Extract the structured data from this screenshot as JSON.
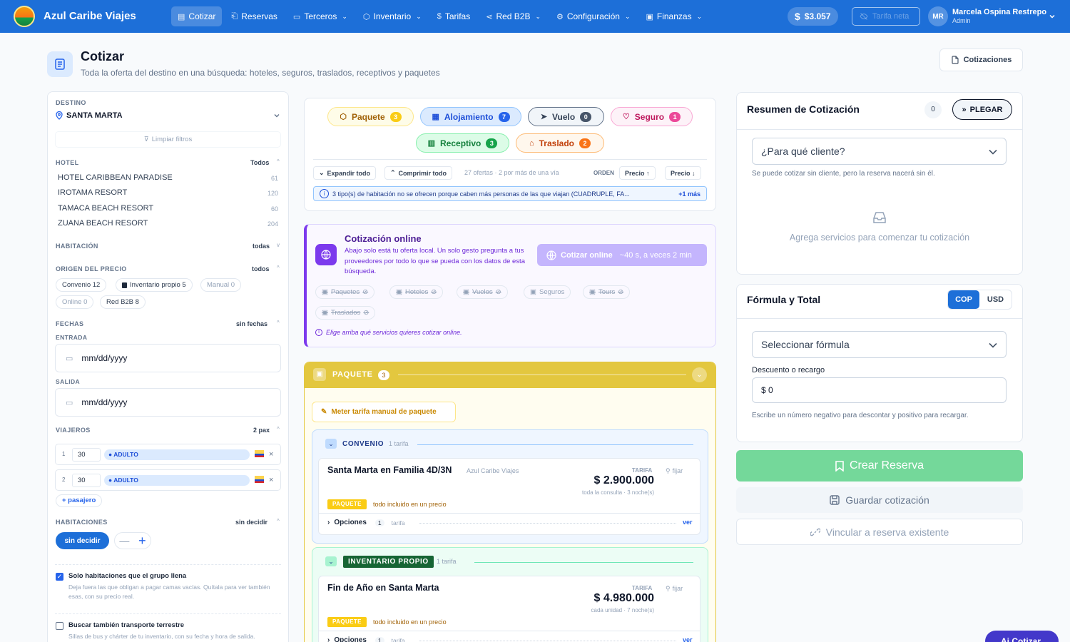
{
  "nav": {
    "brand": "Azul Caribe Viajes",
    "items": [
      {
        "label": "Cotizar",
        "icon": "document-icon",
        "active": true,
        "dropdown": false
      },
      {
        "label": "Reservas",
        "icon": "bookmark-icon",
        "active": false,
        "dropdown": false
      },
      {
        "label": "Terceros",
        "icon": "id-card-icon",
        "active": false,
        "dropdown": true
      },
      {
        "label": "Inventario",
        "icon": "box-icon",
        "active": false,
        "dropdown": true
      },
      {
        "label": "Tarifas",
        "icon": "dollar-icon",
        "active": false,
        "dropdown": false
      },
      {
        "label": "Red B2B",
        "icon": "share-icon",
        "active": false,
        "dropdown": true
      },
      {
        "label": "Configuración",
        "icon": "gear-icon",
        "active": false,
        "dropdown": true
      },
      {
        "label": "Finanzas",
        "icon": "wallet-icon",
        "active": false,
        "dropdown": true
      }
    ],
    "balance": "$3.057",
    "net_rate": "Tarifa neta",
    "user": {
      "initials": "MR",
      "name": "Marcela Ospina Restrepo",
      "role": "Admin"
    }
  },
  "page": {
    "title": "Cotizar",
    "subtitle": "Toda la oferta del destino en una búsqueda: hoteles, seguros, traslados, receptivos y paquetes",
    "quotes_button": "Cotizaciones"
  },
  "filters": {
    "destino_label": "DESTINO",
    "destino": "SANTA MARTA",
    "clear": "Limpiar filtros",
    "hotel_label": "HOTEL",
    "hotel_value": "Todos",
    "hotels": [
      {
        "name": "HOTEL CARIBBEAN PARADISE",
        "count": "61"
      },
      {
        "name": "IROTAMA RESORT",
        "count": "120"
      },
      {
        "name": "TAMACA BEACH RESORT",
        "count": "60"
      },
      {
        "name": "ZUANA BEACH RESORT",
        "count": "204"
      }
    ],
    "room_label": "HABITACIÓN",
    "room_value": "todas",
    "origin_label": "ORIGEN DEL PRECIO",
    "origin_value": "todos",
    "origins": [
      "Convenio 12",
      "Inventario propio 5",
      "Manual 0",
      "Online 0",
      "Red B2B 8"
    ],
    "dates_label": "FECHAS",
    "dates_value": "sin fechas",
    "entry_label": "ENTRADA",
    "exit_label": "SALIDA",
    "date_placeholder": "mm/dd/yyyy",
    "travelers_label": "VIAJEROS",
    "travelers_value": "2 pax",
    "travelers": [
      {
        "n": "1",
        "age": "30",
        "type": "ADULTO"
      },
      {
        "n": "2",
        "age": "30",
        "type": "ADULTO"
      }
    ],
    "add_passenger": "+ pasajero",
    "rooms_label": "HABITACIONES",
    "rooms_value": "sin decidir",
    "rooms_btn": "sin decidir",
    "only_rooms_title": "Solo habitaciones que el grupo llena",
    "only_rooms_desc": "Deja fuera las que obligan a pagar camas vacías. Quítala para ver también esas, con su precio real.",
    "transport_title": "Buscar también transporte terrestre",
    "transport_desc": "Sillas de bus y chárter de tu inventario, con su fecha y hora de salida."
  },
  "categories": [
    {
      "label": "Paquete",
      "count": "3",
      "bg": "#fefce8",
      "border": "#fde68a",
      "color": "#a16207",
      "badge": "#facc15",
      "icon": "box-icon"
    },
    {
      "label": "Alojamiento",
      "count": "7",
      "bg": "#dbeafe",
      "border": "#93c5fd",
      "color": "#1d4ed8",
      "badge": "#2563eb",
      "icon": "building-icon"
    },
    {
      "label": "Vuelo",
      "count": "0",
      "bg": "#f1f5f9",
      "border": "#64748b",
      "color": "#334155",
      "badge": "#475569",
      "icon": "plane-icon"
    },
    {
      "label": "Seguro",
      "count": "1",
      "bg": "#fdf2f8",
      "border": "#f9a8d4",
      "color": "#be185d",
      "badge": "#ec4899",
      "icon": "shield-icon"
    },
    {
      "label": "Receptivo",
      "count": "3",
      "bg": "#dcfce7",
      "border": "#86efac",
      "color": "#15803d",
      "badge": "#16a34a",
      "icon": "map-icon"
    },
    {
      "label": "Traslado",
      "count": "2",
      "bg": "#fff7ed",
      "border": "#fdba74",
      "color": "#c2410c",
      "badge": "#f97316",
      "icon": "bus-icon"
    }
  ],
  "toolbar": {
    "expand": "Expandir todo",
    "collapse": "Comprimir todo",
    "summary": "27 ofertas · 2 por más de una vía",
    "order_label": "ORDEN",
    "sort1": "Precio ↑",
    "sort2": "Precio ↓"
  },
  "notice": {
    "text": "3 tipo(s) de habitación no se ofrecen porque caben más personas de las que viajan (CUADRUPLE, FA...",
    "more": "+1 más"
  },
  "online": {
    "title": "Cotización online",
    "desc": "Abajo solo está tu oferta local. Un solo gesto pregunta a tus proveedores por todo lo que se pueda con los datos de esta búsqueda.",
    "button": "Cotizar online",
    "button_hint": "~40 s, a veces 2 min",
    "services": [
      "Paquetes",
      "Hoteles",
      "Vuelos",
      "Seguros",
      "Tours",
      "Traslados"
    ],
    "hint": "Elige arriba qué servicios quieres cotizar online."
  },
  "package_section": {
    "title": "PAQUETE",
    "count": "3",
    "manual": "Meter tarifa manual de paquete",
    "groups": [
      {
        "name": "CONVENIO",
        "tariffs": "1 tarifa",
        "offer": {
          "title": "Santa Marta en Familia 4D/3N",
          "provider": "Azul Caribe Viajes",
          "tarifa_label": "TARIFA",
          "price": "$ 2.900.000",
          "price_note": "toda la consulta · 3 noche(s)",
          "pin": "fijar",
          "tag": "PAQUETE",
          "tag_desc": "todo incluido en un precio",
          "options_label": "Opciones",
          "options_count": "1",
          "options_unit": "tarifa",
          "see": "ver"
        }
      },
      {
        "name": "INVENTARIO PROPIO",
        "tariffs": "1 tarifa",
        "offer": {
          "title": "Fin de Año en Santa Marta",
          "provider": "",
          "tarifa_label": "TARIFA",
          "price": "$ 4.980.000",
          "price_note": "cada unidad · 7 noche(s)",
          "pin": "fijar",
          "tag": "PAQUETE",
          "tag_desc": "todo incluido en un precio",
          "options_label": "Opciones",
          "options_count": "1",
          "options_unit": "tarifa",
          "see": "ver"
        }
      }
    ]
  },
  "summary": {
    "title": "Resumen de Cotización",
    "count": "0",
    "collapse": "PLEGAR",
    "client_placeholder": "¿Para qué cliente?",
    "client_note": "Se puede cotizar sin cliente, pero la reserva nacerá sin él.",
    "empty": "Agrega servicios para comenzar tu cotización"
  },
  "formula": {
    "title": "Fórmula y Total",
    "cur1": "COP",
    "cur2": "USD",
    "select": "Seleccionar fórmula",
    "discount_label": "Descuento o recargo",
    "discount_value": "$ 0",
    "discount_note": "Escribe un número negativo para descontar y positivo para recargar."
  },
  "actions": {
    "create": "Crear Reserva",
    "save": "Guardar cotización",
    "link": "Vincular a reserva existente",
    "assistant": "Ai Cotizar"
  },
  "colors": {
    "primary": "#1d6fd8",
    "package_yellow": "#e3c73f",
    "online_purple": "#7c3aed",
    "create_green": "#74d89a"
  }
}
